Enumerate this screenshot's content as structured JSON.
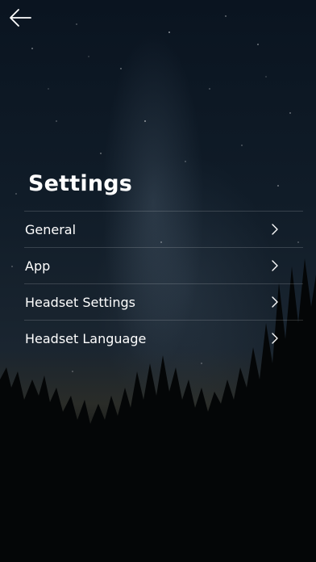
{
  "header": {
    "back_icon": "arrow-left-icon"
  },
  "page": {
    "title": "Settings"
  },
  "menu": {
    "items": [
      {
        "label": "General",
        "icon": "chevron-right-icon"
      },
      {
        "label": "App",
        "icon": "chevron-right-icon"
      },
      {
        "label": "Headset Settings",
        "icon": "chevron-right-icon"
      },
      {
        "label": "Headset Language",
        "icon": "chevron-right-icon"
      }
    ]
  },
  "colors": {
    "text": "#ffffff",
    "divider": "#3a4048",
    "background_top": "#0a1420",
    "background_bottom": "#030404"
  }
}
